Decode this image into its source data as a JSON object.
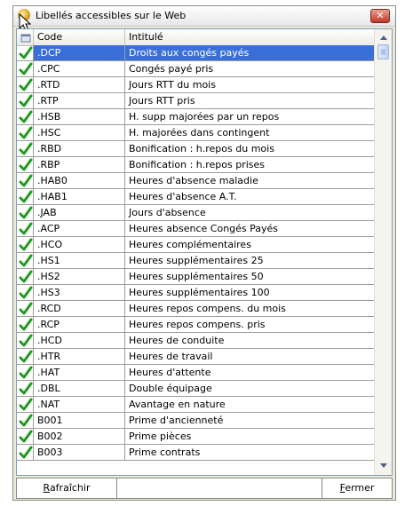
{
  "window": {
    "title": "Libellés accessibles sur le Web",
    "close_label": "✕"
  },
  "grid": {
    "columns": [
      "Code",
      "Intitulé"
    ],
    "selected_index": 0,
    "rows": [
      {
        "code": ".DCP",
        "label": "Droits aux congés payés"
      },
      {
        "code": ".CPC",
        "label": "Congés payé pris"
      },
      {
        "code": ".RTD",
        "label": "Jours RTT du mois"
      },
      {
        "code": ".RTP",
        "label": "Jours RTT pris"
      },
      {
        "code": ".HSB",
        "label": "H. supp majorées par un repos"
      },
      {
        "code": ".HSC",
        "label": "H. majorées dans contingent"
      },
      {
        "code": ".RBD",
        "label": "Bonification : h.repos du mois"
      },
      {
        "code": ".RBP",
        "label": "Bonification : h.repos prises"
      },
      {
        "code": ".HAB0",
        "label": "Heures d'absence maladie"
      },
      {
        "code": ".HAB1",
        "label": "Heures d'absence A.T."
      },
      {
        "code": ".JAB",
        "label": "Jours d'absence"
      },
      {
        "code": ".ACP",
        "label": "Heures absence Congés Payés"
      },
      {
        "code": ".HCO",
        "label": "Heures complémentaires"
      },
      {
        "code": ".HS1",
        "label": "Heures supplémentaires 25"
      },
      {
        "code": ".HS2",
        "label": "Heures supplémentaires 50"
      },
      {
        "code": ".HS3",
        "label": "Heures supplémentaires 100"
      },
      {
        "code": ".RCD",
        "label": "Heures repos compens. du mois"
      },
      {
        "code": ".RCP",
        "label": "Heures repos compens. pris"
      },
      {
        "code": ".HCD",
        "label": "Heures de conduite"
      },
      {
        "code": ".HTR",
        "label": "Heures de travail"
      },
      {
        "code": ".HAT",
        "label": "Heures d'attente"
      },
      {
        "code": ".DBL",
        "label": "Double équipage"
      },
      {
        "code": ".NAT",
        "label": "Avantage en nature"
      },
      {
        "code": "B001",
        "label": "Prime d'ancienneté"
      },
      {
        "code": "B002",
        "label": "Prime pièces"
      },
      {
        "code": "B003",
        "label": "Prime contrats"
      }
    ]
  },
  "buttons": {
    "refresh_hotkey": "R",
    "refresh_rest": "afraîchir",
    "close_hotkey": "F",
    "close_rest": "ermer"
  },
  "icons": {
    "title": "app-icon",
    "check": "checkmark-icon",
    "header": "table-header-icon"
  },
  "colors": {
    "selection": "#3a6fd8",
    "check": "#1f9a1f"
  }
}
